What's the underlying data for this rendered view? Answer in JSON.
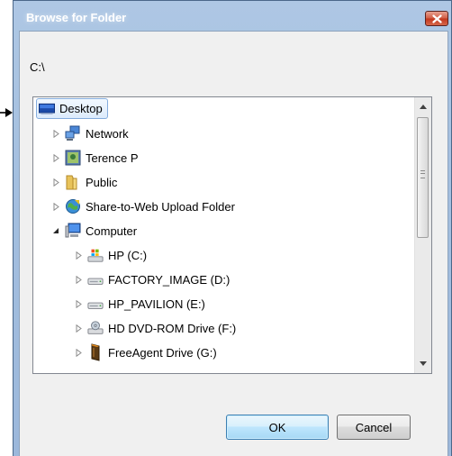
{
  "window": {
    "title": "Browse for Folder"
  },
  "path": {
    "value": "C:\\"
  },
  "tree": {
    "items": [
      {
        "label": "Desktop",
        "icon": "desktop-icon",
        "selected": true
      },
      {
        "label": "Network",
        "icon": "network-icon"
      },
      {
        "label": "Terence P",
        "icon": "user-folder-icon"
      },
      {
        "label": "Public",
        "icon": "folder-icon"
      },
      {
        "label": "Share-to-Web Upload Folder",
        "icon": "share-globe-icon"
      },
      {
        "label": "Computer",
        "icon": "computer-icon",
        "expanded": true
      },
      {
        "label": "HP (C:)",
        "icon": "system-drive-icon"
      },
      {
        "label": "FACTORY_IMAGE (D:)",
        "icon": "hard-drive-icon"
      },
      {
        "label": "HP_PAVILION (E:)",
        "icon": "hard-drive-icon"
      },
      {
        "label": "HD DVD-ROM Drive (F:)",
        "icon": "dvd-drive-icon"
      },
      {
        "label": "FreeAgent Drive (G:)",
        "icon": "external-drive-icon"
      }
    ]
  },
  "buttons": {
    "ok_label": "OK",
    "cancel_label": "Cancel"
  },
  "colors": {
    "title_bar": "#a4bfdf",
    "close_button": "#c2351c",
    "selection_border": "#84acdd",
    "default_button_border": "#3c7fb1"
  }
}
